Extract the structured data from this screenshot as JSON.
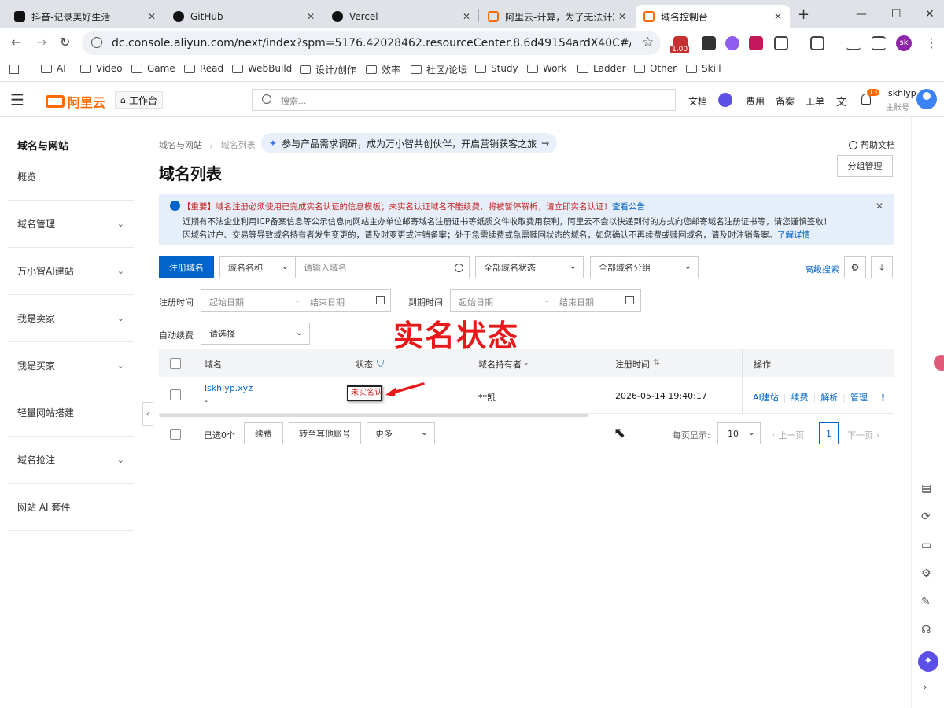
{
  "browser": {
    "tabs": [
      {
        "title": "抖音-记录美好生活",
        "close": "✕",
        "color": "#111"
      },
      {
        "title": "GitHub",
        "close": "✕",
        "color": "#111"
      },
      {
        "title": "Vercel",
        "close": "✕",
        "color": "#111"
      },
      {
        "title": "阿里云-计算，为了无法计算的",
        "close": "✕",
        "color": "#ff6a00"
      },
      {
        "title": "域名控制台",
        "close": "✕",
        "color": "#ff6a00"
      }
    ],
    "new_tab": "+",
    "window_controls": {
      "minimize": "—",
      "maximize": "☐",
      "close": "✕"
    },
    "nav": {
      "back": "←",
      "forward": "→",
      "reload": "↻"
    },
    "url": "dc.console.aliyun.com/next/index?spm=5176.42028462.resourceCenter.8.6d49154ardX40C#/domain-list/all?type=",
    "star": "☆",
    "ext_badge": "1.00",
    "profile": "sk",
    "menu": "⋮",
    "bookmarks": [
      "AI",
      "Video",
      "Game",
      "Read",
      "WebBuild",
      "设计/创作",
      "效率",
      "社区/论坛",
      "Study",
      "Work",
      "Ladder",
      "Other",
      "Skill"
    ]
  },
  "header": {
    "menu_icon": "☰",
    "logo_text": "阿里云",
    "workbench": "工作台",
    "search_placeholder": "搜索...",
    "links": [
      "文档",
      "费用",
      "备案",
      "工单"
    ],
    "notify_count": "13",
    "username": "lskhlyp",
    "account_type": "主账号"
  },
  "sidebar": {
    "title": "域名与网站",
    "items": [
      {
        "label": "概览",
        "expand": false
      },
      {
        "label": "域名管理",
        "expand": true
      },
      {
        "label": "万小智AI建站",
        "expand": true
      },
      {
        "label": "我是卖家",
        "expand": true
      },
      {
        "label": "我是买家",
        "expand": true
      },
      {
        "label": "轻量网站搭建",
        "expand": false
      },
      {
        "label": "域名抢注",
        "expand": true
      },
      {
        "label": "网站 AI 套件",
        "expand": false
      }
    ],
    "collapse": "‹"
  },
  "main": {
    "breadcrumb": [
      "域名与网站",
      "域名列表"
    ],
    "breadcrumb_sep": "/",
    "promo": "参与产品需求调研，成为万小智共创伙伴，开启营销获客之旅",
    "promo_arrow": "→",
    "help": "帮助文档",
    "title": "域名列表",
    "group_manage": "分组管理",
    "notice": {
      "line1_prefix": "【重要】域名注册必须使用已完成实名认证的信息模板；未实名认证域名不能续费、将被暂停解析，请立即实名认证！",
      "line1_link": "查看公告",
      "line2": "近期有不法企业利用ICP备案信息等公示信息向网站主办单位邮寄域名注册证书等纸质文件收取费用获利，阿里云不会以快递到付的方式向您邮寄域名注册证书等，请您谨慎签收！",
      "line3": "因域名过户、交易等导致域名持有者发生变更的，请及时变更或注销备案；处于急需续费或急需赎回状态的域名，如您确认不再续费或赎回域名，请及时注销备案。",
      "line3_link": "了解详情",
      "close": "✕"
    },
    "filters": {
      "register_button": "注册域名",
      "name_type": "域名名称",
      "name_placeholder": "请输入域名",
      "status_select": "全部域名状态",
      "group_select": "全部域名分组",
      "advanced": "高级搜索",
      "reg_time_label": "注册时间",
      "expire_time_label": "到期时间",
      "start_placeholder": "起始日期",
      "end_placeholder": "结束日期",
      "range_sep": "-",
      "auto_renew_label": "自动续费",
      "auto_renew_placeholder": "请选择"
    },
    "annotation": "实名状态",
    "table": {
      "headers": {
        "domain": "域名",
        "status": "状态",
        "holder": "域名持有者",
        "reg_time": "注册时间",
        "actions": "操作"
      },
      "rows": [
        {
          "domain": "lskhlyp.xyz",
          "sub": "-",
          "status": "未实名认",
          "holder": "**凯",
          "reg_time": "2026-05-14 19:40:17",
          "actions": [
            "AI建站",
            "续费",
            "解析",
            "管理"
          ]
        }
      ],
      "more": "⋮"
    },
    "footer": {
      "selected": "已选0个",
      "renew": "续费",
      "transfer": "转至其他账号",
      "more": "更多",
      "per_page_label": "每页显示:",
      "per_page": "10",
      "prev": "上一页",
      "page": "1",
      "next": "下一页"
    }
  }
}
